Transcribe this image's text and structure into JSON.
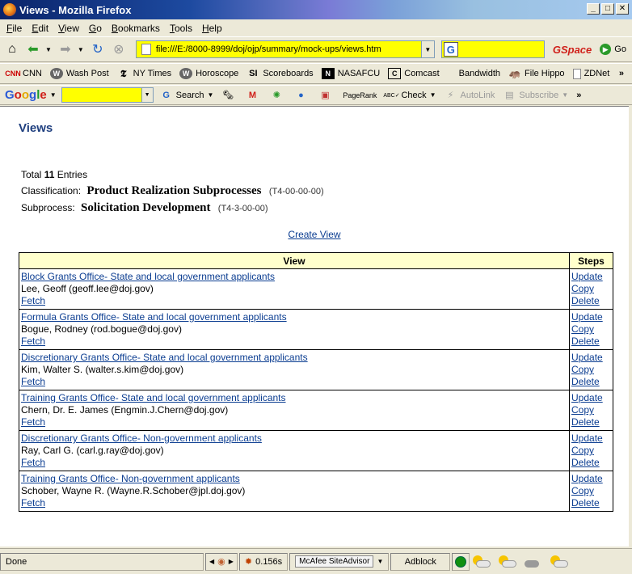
{
  "window": {
    "title": "Views - Mozilla Firefox"
  },
  "menu": [
    "File",
    "Edit",
    "View",
    "Go",
    "Bookmarks",
    "Tools",
    "Help"
  ],
  "nav": {
    "url": "file:///E:/8000-8999/doj/ojp/summary/mock-ups/views.htm",
    "gspace": "GSpace",
    "go_label": "Go"
  },
  "bookmarks": [
    {
      "label": "CNN",
      "icon": "cnn-icon"
    },
    {
      "label": "Wash Post",
      "icon": "washpost-icon"
    },
    {
      "label": "NY Times",
      "icon": "nytimes-icon"
    },
    {
      "label": "Horoscope",
      "icon": "horoscope-icon"
    },
    {
      "label": "Scoreboards",
      "icon": "si-icon"
    },
    {
      "label": "NASAFCU",
      "icon": "nasafcu-icon"
    },
    {
      "label": "Comcast",
      "icon": "comcast-icon"
    },
    {
      "label": "Bandwidth",
      "icon": ""
    },
    {
      "label": "File Hippo",
      "icon": "filehippo-icon"
    },
    {
      "label": "ZDNet",
      "icon": "page-icon"
    }
  ],
  "google_toolbar": {
    "logo": "Google",
    "search_label": "Search",
    "pagerank_label": "PageRank",
    "check_label": "Check",
    "autolink_label": "AutoLink",
    "subscribe_label": "Subscribe"
  },
  "page": {
    "title": "Views",
    "total_prefix": "Total",
    "total_count": "11",
    "total_suffix": "Entries",
    "classification_label": "Classification:",
    "classification_value": "Product Realization Subprocesses",
    "classification_code": "(T4-00-00-00)",
    "subprocess_label": "Subprocess:",
    "subprocess_value": "Solicitation Development",
    "subprocess_code": "(T4-3-00-00)",
    "create_view": "Create View",
    "table": {
      "col_view": "View",
      "col_steps": "Steps",
      "rows": [
        {
          "view": "Block Grants Office- State and local government applicants",
          "owner": "Lee, Geoff (geoff.lee@doj.gov)",
          "fetch": "Fetch",
          "update": "Update",
          "copy": "Copy",
          "delete": "Delete"
        },
        {
          "view": "Formula Grants Office- State and local government applicants",
          "owner": "Bogue, Rodney (rod.bogue@doj.gov)",
          "fetch": "Fetch",
          "update": "Update",
          "copy": "Copy",
          "delete": "Delete"
        },
        {
          "view": "Discretionary Grants Office- State and local government applicants",
          "owner": "Kim, Walter S. (walter.s.kim@doj.gov)",
          "fetch": "Fetch",
          "update": "Update",
          "copy": "Copy",
          "delete": "Delete"
        },
        {
          "view": "Training Grants Office- State and local government applicants",
          "owner": "Chern, Dr. E. James (Engmin.J.Chern@doj.gov)",
          "fetch": "Fetch",
          "update": "Update",
          "copy": "Copy",
          "delete": "Delete"
        },
        {
          "view": "Discretionary Grants Office- Non-government applicants",
          "owner": "Ray, Carl G. (carl.g.ray@doj.gov)",
          "fetch": "Fetch",
          "update": "Update",
          "copy": "Copy",
          "delete": "Delete"
        },
        {
          "view": "Training Grants Office- Non-government applicants",
          "owner": "Schober, Wayne R. (Wayne.R.Schober@jpl.doj.gov)",
          "fetch": "Fetch",
          "update": "Update",
          "copy": "Copy",
          "delete": "Delete"
        }
      ]
    }
  },
  "status": {
    "text": "Done",
    "timing": "0.156s",
    "siteadvisor": "McAfee SiteAdvisor",
    "adblock": "Adblock"
  }
}
